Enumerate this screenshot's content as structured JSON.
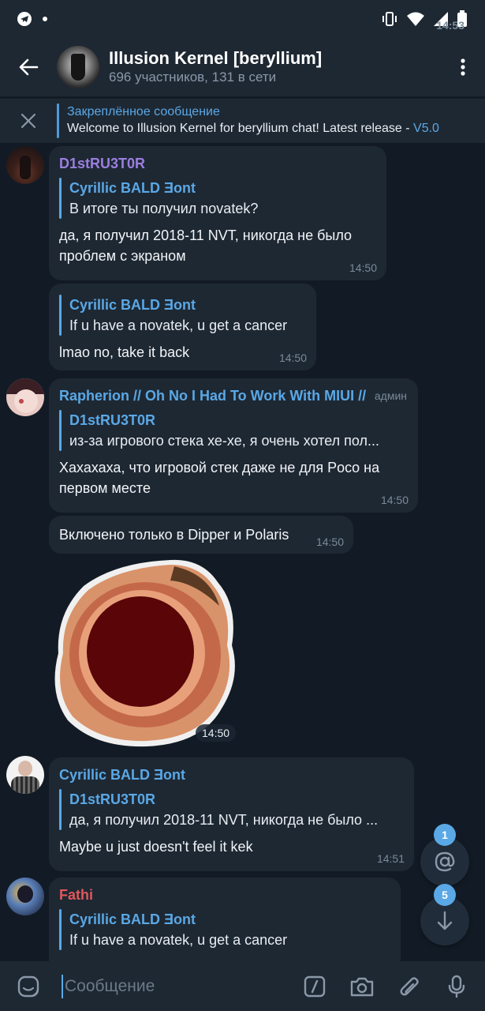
{
  "status_bar": {
    "time": "14:53"
  },
  "header": {
    "title": "Illusion Kernel [beryllium]",
    "subtitle": "696 участников, 131 в сети"
  },
  "pinned": {
    "title": "Закреплённое сообщение",
    "body": "Welcome to Illusion Kernel for beryllium chat! Latest release - ",
    "link": "V5.0"
  },
  "messages": [
    {
      "sender": "D1stRU3T0R",
      "sender_color": "#9b7fe0",
      "reply_name": "Cyrillic BALD Ǝont",
      "reply_text": "В итоге ты получил novatek?",
      "text": "да, я получил 2018-11 NVT, никогда не было проблем с экраном",
      "time": "14:50"
    },
    {
      "reply_name": "Cyrillic BALD Ǝont",
      "reply_text": "If u have a novatek, u get a cancer",
      "text": "lmao no, take it back",
      "time": "14:50"
    },
    {
      "sender": "Rapherion // Oh No I Had To Work With MIUI //",
      "sender_color": "#5aa8e6",
      "badge": "админ",
      "reply_name": "D1stRU3T0R",
      "reply_text": "из-за игрового стека хе-хе, я очень хотел пол...",
      "text": "Хахахаха, что игровой стек даже не для Poco на первом месте",
      "time": "14:50"
    },
    {
      "text": "Включено только в Dipper и Polaris",
      "time": "14:50"
    },
    {
      "sticker_time": "14:50"
    },
    {
      "sender": "Cyrillic BALD Ǝont",
      "sender_color": "#5aa8e6",
      "reply_name": "D1stRU3T0R",
      "reply_text": "да, я получил 2018-11 NVT, никогда не было ...",
      "text": "Maybe u just doesn't feel it kek",
      "time": "14:51"
    },
    {
      "sender": "Fathi",
      "sender_color": "#e0585b",
      "reply_name": "Cyrillic BALD Ǝont",
      "reply_text": "If u have a novatek, u get a cancer"
    }
  ],
  "fabs": {
    "mentions_count": "1",
    "unread_count": "5"
  },
  "input": {
    "placeholder": "Сообщение"
  },
  "colors": {
    "background": "#121b25",
    "bubble": "#1e2833",
    "accent": "#5aa8e6"
  }
}
